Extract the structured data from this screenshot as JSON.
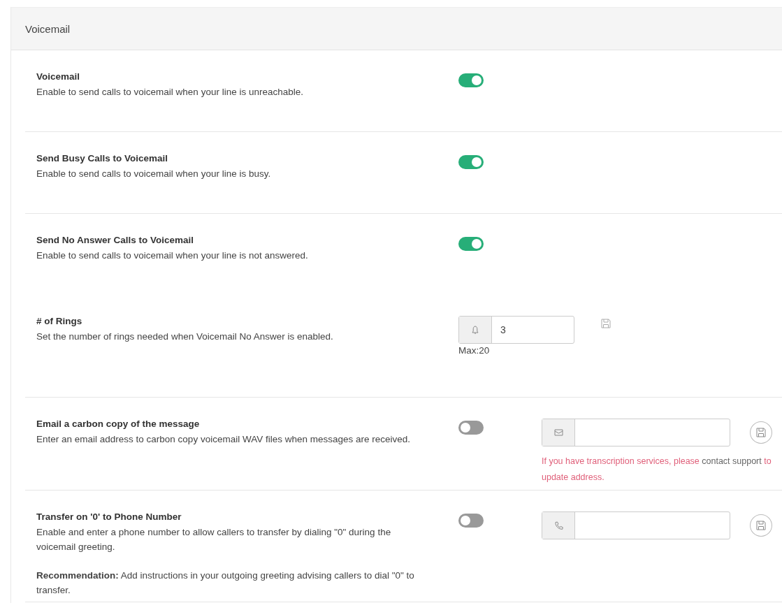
{
  "panel": {
    "title": "Voicemail"
  },
  "sections": [
    {
      "items": [
        {
          "kind": "toggle",
          "title": "Voicemail",
          "description": "Enable to send calls to voicemail when your line is unreachable.",
          "on": true
        }
      ]
    },
    {
      "items": [
        {
          "kind": "toggle",
          "title": "Send Busy Calls to Voicemail",
          "description": "Enable to send calls to voicemail when your line is busy.",
          "on": true
        }
      ]
    },
    {
      "items": [
        {
          "kind": "toggle",
          "title": "Send No Answer Calls to Voicemail",
          "description": "Enable to send calls to voicemail when your line is not answered.",
          "on": true
        },
        {
          "kind": "number",
          "title": "# of Rings",
          "description": "Set the number of rings needed when Voicemail No Answer is enabled.",
          "field": {
            "kind": "bell",
            "value": "3"
          },
          "hint": "Max:20"
        }
      ]
    },
    {
      "items": [
        {
          "kind": "toggle-field",
          "title": "Email a carbon copy of the message",
          "description": "Enter an email address to carbon copy voicemail WAV files when messages are received.",
          "on": false,
          "field": {
            "kind": "email"
          },
          "notice": {
            "before": "If you have transcription services, please",
            "link": "contact support",
            "after": "to update address."
          }
        }
      ]
    },
    {
      "items": [
        {
          "kind": "toggle-field",
          "title": "Transfer on '0' to Phone Number",
          "description": "Enable and enter a phone number to allow callers to transfer by dialing \"0\" during the voicemail greeting.",
          "note": "**Recommendation:** Add instructions in your outgoing greeting advising callers to dial \"0\" to transfer.",
          "on": false,
          "field": {
            "kind": "phone"
          }
        }
      ]
    }
  ]
}
